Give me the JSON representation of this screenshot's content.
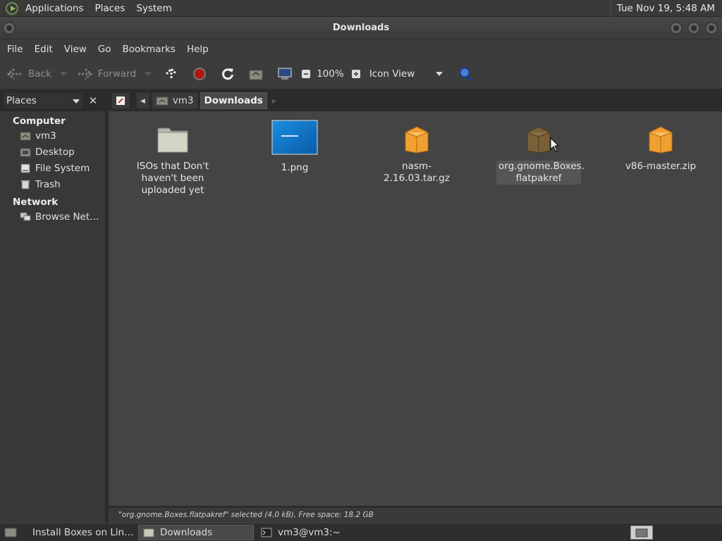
{
  "top_panel": {
    "menu": [
      "Applications",
      "Places",
      "System"
    ],
    "clock": "Tue Nov 19,  5:48 AM"
  },
  "window": {
    "title": "Downloads"
  },
  "menubar": [
    "File",
    "Edit",
    "View",
    "Go",
    "Bookmarks",
    "Help"
  ],
  "toolbar": {
    "back_label": "Back",
    "forward_label": "Forward",
    "zoom_level": "100%",
    "view_mode": "Icon View"
  },
  "sidebar_header": {
    "label": "Places"
  },
  "path": {
    "parent": "vm3",
    "current": "Downloads"
  },
  "sidebar": {
    "computer_label": "Computer",
    "computer_items": [
      {
        "label": "vm3",
        "icon": "home-folder-icon"
      },
      {
        "label": "Desktop",
        "icon": "desktop-folder-icon"
      },
      {
        "label": "File System",
        "icon": "drive-icon"
      },
      {
        "label": "Trash",
        "icon": "trash-icon"
      }
    ],
    "network_label": "Network",
    "network_items": [
      {
        "label": "Browse Net…",
        "icon": "network-icon"
      }
    ]
  },
  "files": [
    {
      "name": "ISOs that Don't haven't been uploaded yet",
      "lines": [
        "ISOs that Don't",
        "haven't been",
        "uploaded yet"
      ],
      "type": "folder"
    },
    {
      "name": "1.png",
      "lines": [
        "1.png"
      ],
      "type": "image"
    },
    {
      "name": "nasm-2.16.03.tar.gz",
      "lines": [
        "nasm-2.16.03.tar.gz"
      ],
      "type": "archive"
    },
    {
      "name": "org.gnome.Boxes.flatpakref",
      "lines": [
        "org.gnome.Boxes.",
        "flatpakref"
      ],
      "type": "package",
      "selected": true
    },
    {
      "name": "v86-master.zip",
      "lines": [
        "v86-master.zip"
      ],
      "type": "archive"
    }
  ],
  "statusbar": "\"org.gnome.Boxes.flatpakref\" selected (4.0 kB), Free space: 18.2 GB",
  "taskbar": [
    {
      "label": "Install Boxes on Lin…",
      "icon": "browser-icon",
      "active": false
    },
    {
      "label": "Downloads",
      "icon": "folder-icon",
      "active": true
    },
    {
      "label": "vm3@vm3:~",
      "icon": "terminal-icon",
      "active": false
    }
  ],
  "colors": {
    "background": "#444444",
    "panel": "#3a3a3a",
    "archive_orange": "#f0a030"
  }
}
